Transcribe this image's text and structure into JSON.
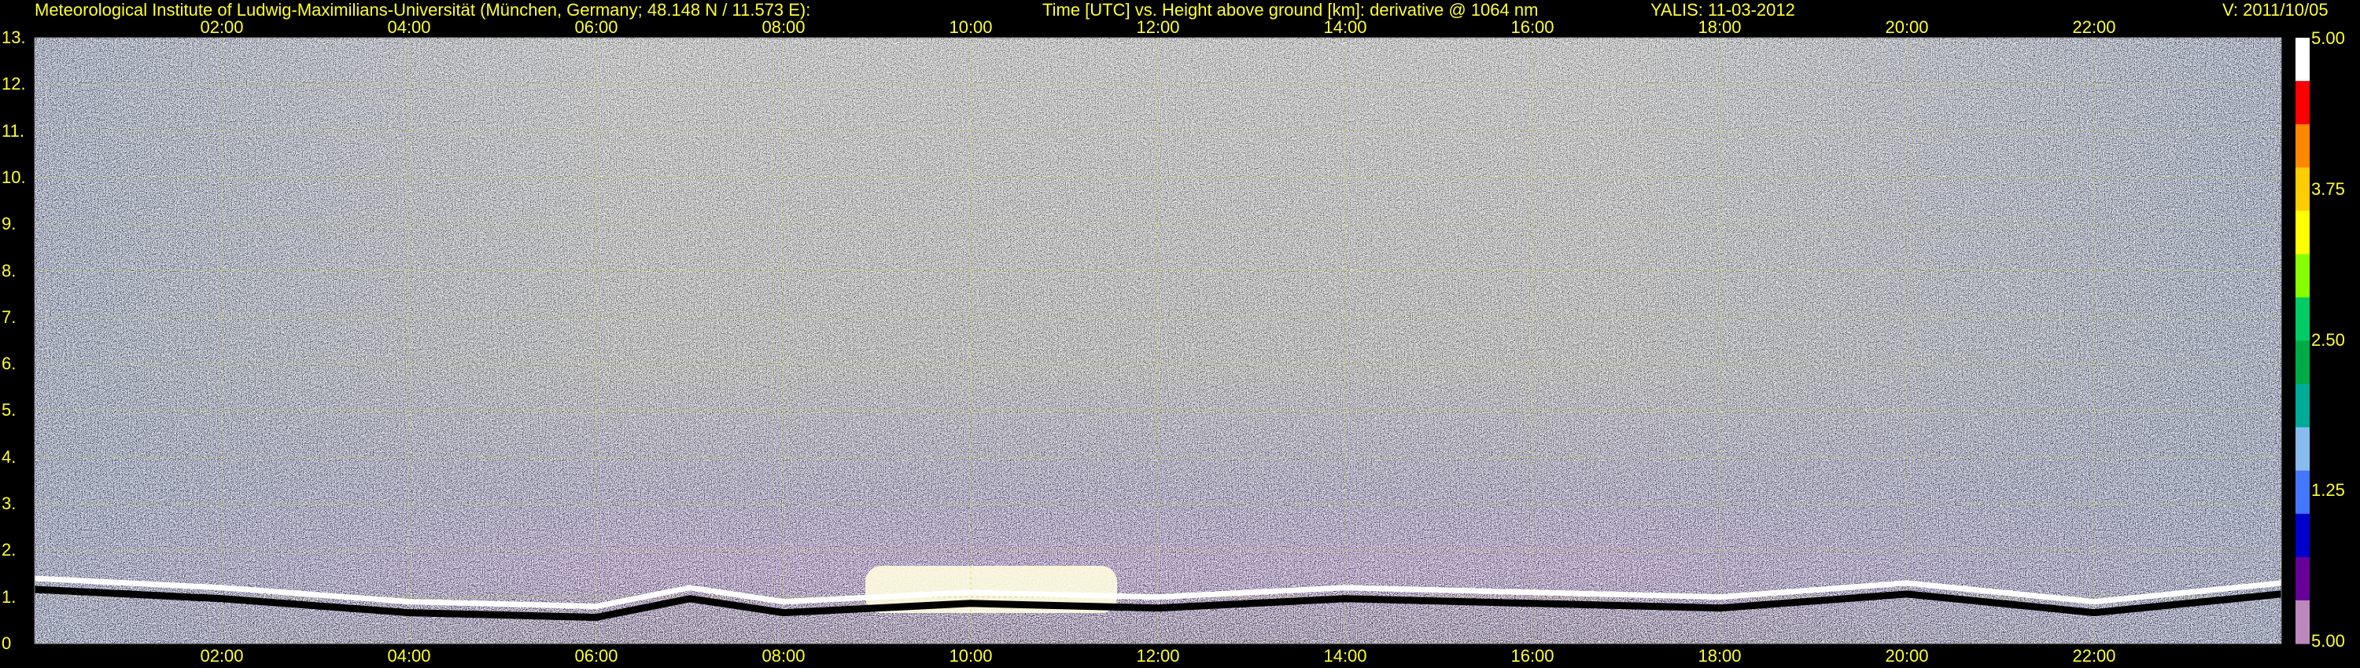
{
  "header": {
    "institute": "Meteorological Institute of Ludwig-Maximilians-Universität (München, Germany; 48.148 N / 11.573 E):",
    "description": "Time [UTC] vs. Height above ground [km]: derivative @ 1064 nm",
    "instrument": "YALIS: 11-03-2012",
    "version": "V: 2011/10/05"
  },
  "chart_data": {
    "type": "heatmap",
    "title": "",
    "xlabel": "Time [UTC]",
    "ylabel": "Height above ground [km]",
    "xlim": [
      0,
      24
    ],
    "ylim": [
      0,
      13
    ],
    "x_ticks": [
      2,
      4,
      6,
      8,
      10,
      12,
      14,
      16,
      18,
      20,
      22
    ],
    "x_tick_labels": [
      "02:00",
      "04:00",
      "06:00",
      "08:00",
      "10:00",
      "12:00",
      "14:00",
      "16:00",
      "18:00",
      "20:00",
      "22:00"
    ],
    "y_ticks": [
      0,
      1,
      2,
      3,
      4,
      5,
      6,
      7,
      8,
      9,
      10,
      11,
      12,
      13
    ],
    "y_tick_labels": [
      "0",
      "1.",
      "2.",
      "3.",
      "4.",
      "5.",
      "6.",
      "7.",
      "8.",
      "9.",
      "10.",
      "11.",
      "12.",
      "13."
    ],
    "grid": true,
    "colorbar": {
      "ticks": [
        5.0,
        3.75,
        2.5,
        1.25,
        5.0
      ],
      "tick_labels": [
        "5.00",
        "3.75",
        "2.50",
        "1.25",
        "5.00"
      ],
      "colors": [
        "#ffffff",
        "#ff0000",
        "#ff8800",
        "#ffcc00",
        "#ffff00",
        "#88ff00",
        "#00cc66",
        "#00aa44",
        "#00aa99",
        "#88bbee",
        "#4477ff",
        "#0000cc",
        "#660099",
        "#bb88bb"
      ]
    },
    "boundary_layer_top_km": [
      {
        "time": 0.0,
        "height": 1.4
      },
      {
        "time": 2.0,
        "height": 1.2
      },
      {
        "time": 4.0,
        "height": 0.9
      },
      {
        "time": 6.0,
        "height": 0.8
      },
      {
        "time": 7.0,
        "height": 1.2
      },
      {
        "time": 8.0,
        "height": 0.9
      },
      {
        "time": 10.0,
        "height": 1.1
      },
      {
        "time": 12.0,
        "height": 1.0
      },
      {
        "time": 14.0,
        "height": 1.2
      },
      {
        "time": 16.0,
        "height": 1.1
      },
      {
        "time": 18.0,
        "height": 1.0
      },
      {
        "time": 20.0,
        "height": 1.3
      },
      {
        "time": 22.0,
        "height": 0.9
      },
      {
        "time": 24.0,
        "height": 1.3
      }
    ]
  }
}
